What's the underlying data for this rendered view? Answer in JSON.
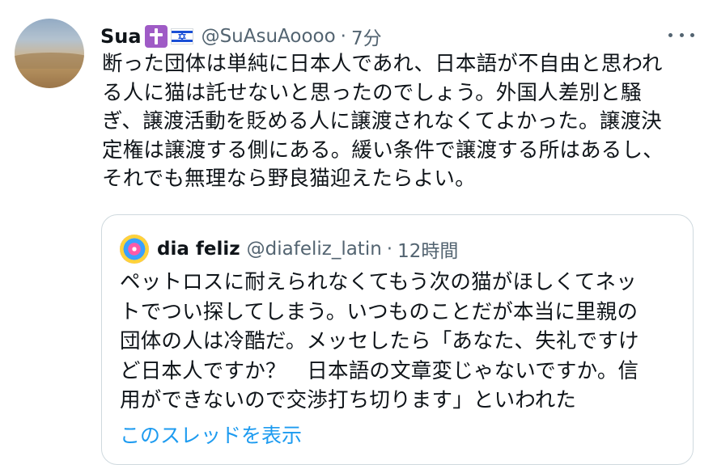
{
  "tweet": {
    "display_name": "Sua",
    "emoji_icons": [
      "latin-cross-icon",
      "israel-flag-icon"
    ],
    "handle": "@SuAsuAoooo",
    "separator": "·",
    "time": "7分",
    "text_lines": [
      "断った団体は単純に日本人であれ、日本語が不自由と思われ",
      "る人に猫は託せないと思ったのでしょう。外国人差別と騒",
      "ぎ、譲渡活動を貶める人に譲渡されなくてよかった。譲渡決",
      "定権は譲渡する側にある。緩い条件で譲渡する所はあるし、",
      "それでも無理なら野良猫迎えたらよい。"
    ]
  },
  "quote": {
    "display_name": "dia feliz",
    "handle": "@diafeliz_latin",
    "separator": "·",
    "time": "12時間",
    "text_lines": [
      "ペットロスに耐えられなくてもう次の猫がほしくてネッ",
      "トでつい探してしまう。いつものことだが本当に里親の",
      "団体の人は冷酷だ。メッセしたら「あなた、失礼ですけ",
      "ど日本人ですか？　日本語の文章変じゃないですか。信",
      "用ができないので交渉打ち切ります」といわれた"
    ],
    "thread_link": "このスレッドを表示"
  },
  "colors": {
    "text": "#0f1419",
    "secondary": "#536471",
    "link": "#1d9bf0",
    "border": "#cfd9de",
    "cross_badge": "#9f5bc6",
    "flag_blue": "#1a4fd6"
  }
}
